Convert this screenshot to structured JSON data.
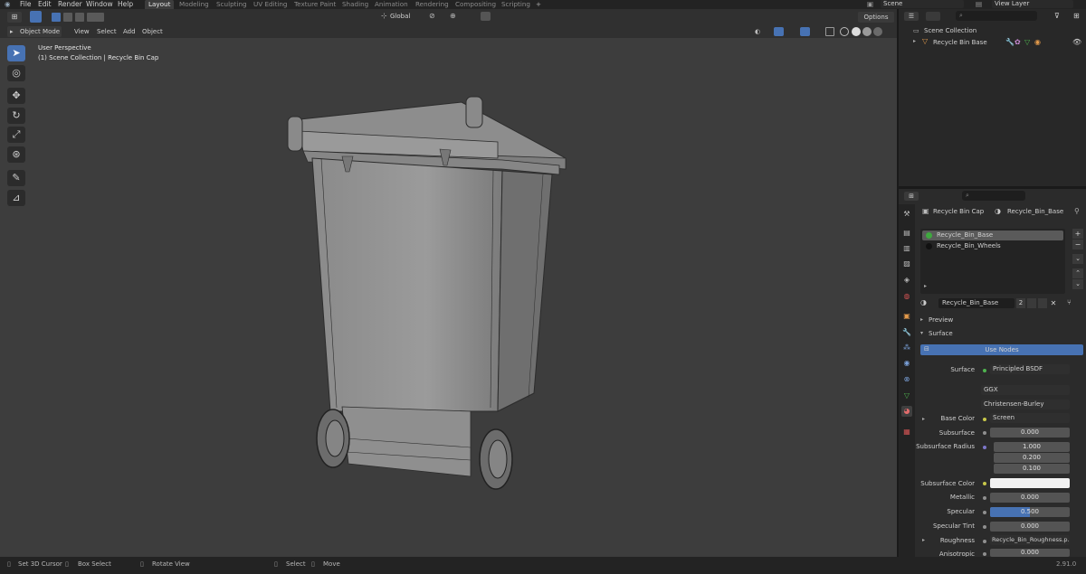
{
  "app": {
    "menu": [
      "File",
      "Edit",
      "Render",
      "Window",
      "Help"
    ],
    "workspaces": [
      {
        "label": "Layout",
        "active": true
      },
      {
        "label": "Modeling",
        "active": false
      },
      {
        "label": "Sculpting",
        "active": false
      },
      {
        "label": "UV Editing",
        "active": false
      },
      {
        "label": "Texture Paint",
        "active": false
      },
      {
        "label": "Shading",
        "active": false
      },
      {
        "label": "Animation",
        "active": false
      },
      {
        "label": "Rendering",
        "active": false
      },
      {
        "label": "Compositing",
        "active": false
      },
      {
        "label": "Scripting",
        "active": false
      }
    ],
    "add_workspace": "+",
    "scene": "Scene",
    "view_layer": "View Layer"
  },
  "viewport": {
    "mode": "Object Mode",
    "menus": [
      "View",
      "Select",
      "Add",
      "Object"
    ],
    "transform_orientation": "Global",
    "options": "Options",
    "overlay_line1": "User Perspective",
    "overlay_line2": "(1) Scene Collection | Recycle Bin Cap",
    "tools": [
      "select-box-tool",
      "cursor-tool",
      "move-tool",
      "rotate-tool",
      "scale-tool",
      "transform-tool",
      "annotate-tool",
      "measure-tool"
    ]
  },
  "outliner": {
    "root": "Scene Collection",
    "items": [
      {
        "label": "Recycle Bin Base"
      }
    ]
  },
  "properties": {
    "object_name": "Recycle Bin Cap",
    "material_name": "Recycle_Bin_Base",
    "slots": [
      "Recycle_Bin_Base",
      "Recycle_Bin_Wheels"
    ],
    "material_field": "Recycle_Bin_Base",
    "user_count": "2",
    "panels": {
      "preview": "Preview",
      "surface": "Surface"
    },
    "use_nodes": "Use Nodes",
    "surface": {
      "label": "Surface",
      "value": "Principled BSDF"
    },
    "distribution": "GGX",
    "subsurface_method": "Christensen-Burley",
    "rows": [
      {
        "label": "Base Color",
        "value": "Screen",
        "kind": "link"
      },
      {
        "label": "Subsurface",
        "value": "0.000",
        "kind": "num"
      },
      {
        "label": "Subsurface Radius",
        "value": "1.000",
        "kind": "num"
      },
      {
        "label": "",
        "value": "0.200",
        "kind": "num"
      },
      {
        "label": "",
        "value": "0.100",
        "kind": "num"
      },
      {
        "label": "Subsurface Color",
        "value": "",
        "kind": "color"
      },
      {
        "label": "Metallic",
        "value": "0.000",
        "kind": "num"
      },
      {
        "label": "Specular",
        "value": "0.500",
        "kind": "num-blue"
      },
      {
        "label": "Specular Tint",
        "value": "0.000",
        "kind": "num"
      },
      {
        "label": "Roughness",
        "value": "Recycle_Bin_Roughness.p...",
        "kind": "link"
      },
      {
        "label": "Anisotropic",
        "value": "0.000",
        "kind": "num"
      }
    ]
  },
  "statusbar": {
    "items": [
      "Set 3D Cursor",
      "Box Select",
      "Rotate View",
      "Select",
      "Move"
    ],
    "version": "2.91.0"
  },
  "colors": {
    "accent": "#4772b3",
    "viewport_bg": "#3d3d3d",
    "panel_bg": "#2b2b2b"
  }
}
